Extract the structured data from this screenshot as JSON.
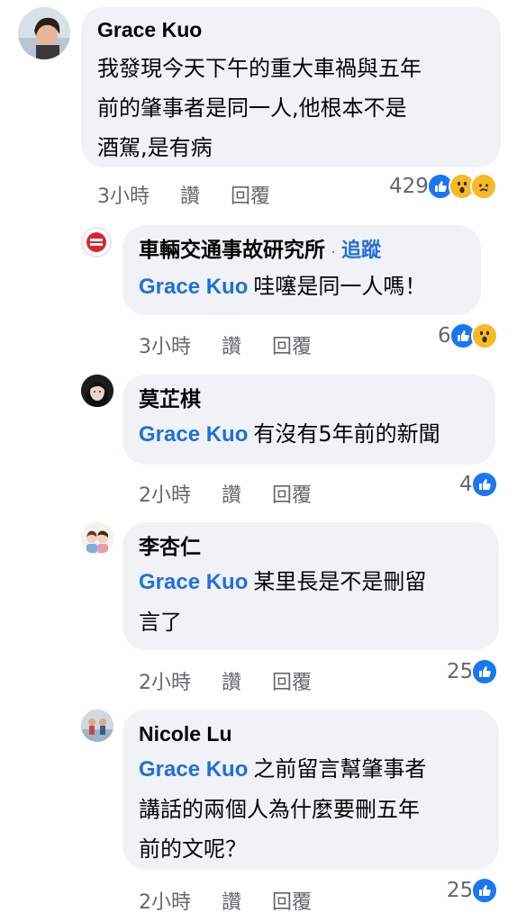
{
  "comments": [
    {
      "author": "Grace Kuo",
      "lines": [
        "我發現今天下午的重大車禍與五年",
        "前的肇事者是同一人,他根本不是",
        "酒駕,是有病"
      ],
      "time": "3小時",
      "like_label": "讚",
      "reply_label": "回覆",
      "reactions_count": "429",
      "reactions": [
        "like-icon",
        "wow-icon",
        "sad-icon"
      ]
    },
    {
      "author": "車輛交通事故研究所",
      "follow_label": "追蹤",
      "mention": "Grace Kuo",
      "lines": [
        "哇噻是同一人嗎！"
      ],
      "time": "3小時",
      "like_label": "讚",
      "reply_label": "回覆",
      "reactions_count": "6",
      "reactions": [
        "like-icon",
        "wow-icon"
      ]
    },
    {
      "author": "莫芷棋",
      "mention": "Grace Kuo",
      "lines": [
        "有沒有5年前的新聞"
      ],
      "time": "2小時",
      "like_label": "讚",
      "reply_label": "回覆",
      "reactions_count": "4",
      "reactions": [
        "like-icon"
      ]
    },
    {
      "author": "李杏仁",
      "mention": "Grace Kuo",
      "lines": [
        "某里長是不是刪留",
        "言了"
      ],
      "time": "2小時",
      "like_label": "讚",
      "reply_label": "回覆",
      "reactions_count": "25",
      "reactions": [
        "like-icon"
      ]
    },
    {
      "author": "Nicole Lu",
      "mention": "Grace Kuo",
      "lines": [
        "之前留言幫肇事者",
        "講話的兩個人為什麼要刪五年",
        "前的文呢？"
      ],
      "time": "2小時",
      "like_label": "讚",
      "reply_label": "回覆",
      "reactions_count": "25",
      "reactions": [
        "like-icon"
      ]
    }
  ],
  "colors": {
    "bubble": "#f0f2f5",
    "mention": "#216fdb",
    "meta": "#65676b",
    "like": "#1877f2",
    "emoji": "#f7b928"
  }
}
